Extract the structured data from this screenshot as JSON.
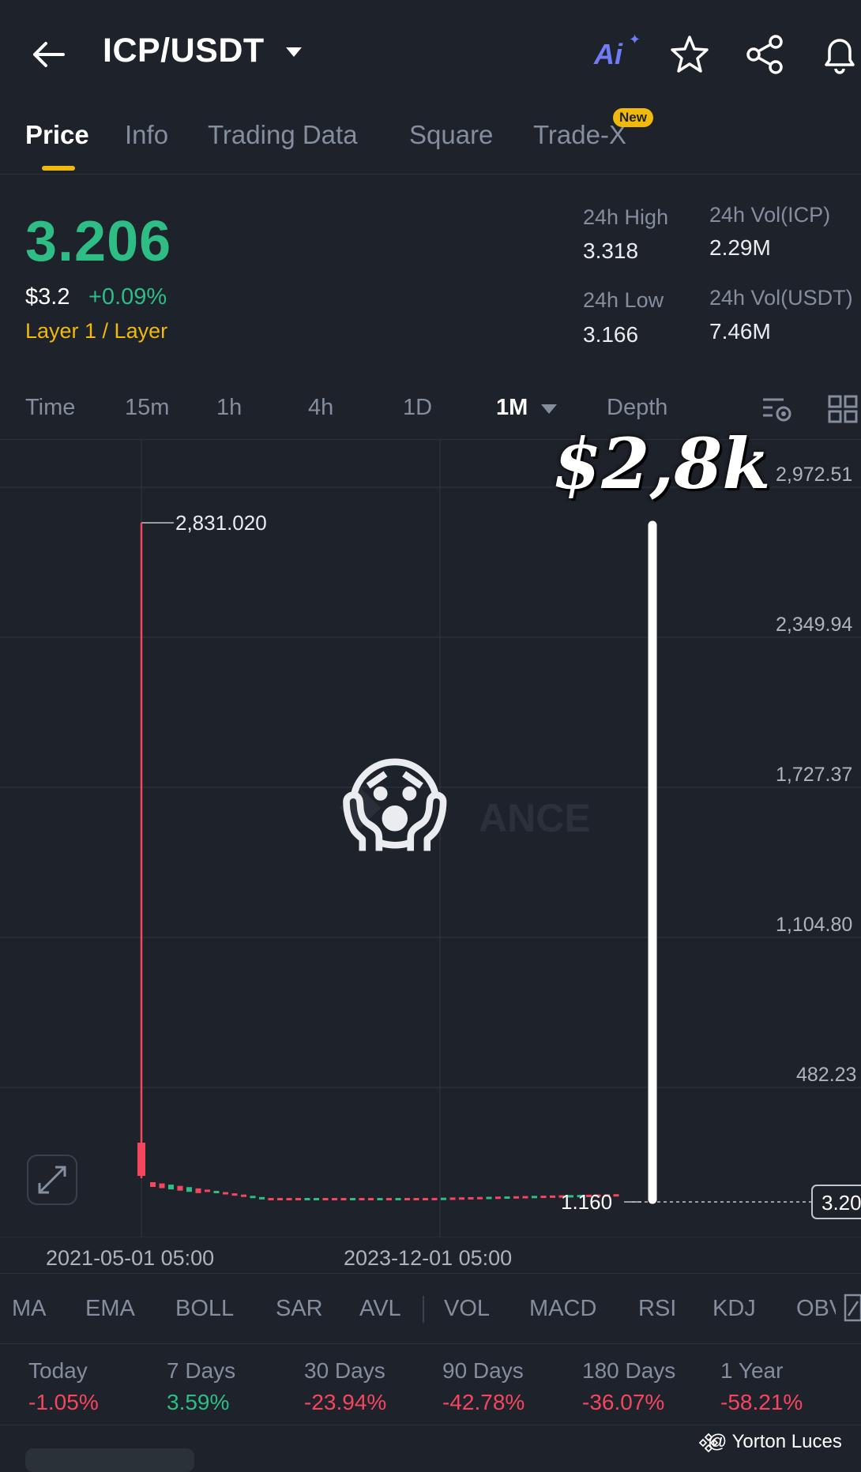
{
  "header": {
    "pair": "ICP/USDT",
    "ai_label": "Ai",
    "icons": [
      "back-arrow-icon",
      "caret-down-icon",
      "ai-icon",
      "star-icon",
      "share-icon",
      "bell-icon"
    ]
  },
  "tabs": [
    {
      "label": "Price",
      "active": true
    },
    {
      "label": "Info"
    },
    {
      "label": "Trading Data"
    },
    {
      "label": "Square"
    },
    {
      "label": "Trade-X",
      "badge": "New"
    }
  ],
  "ticker": {
    "last_price": "3.206",
    "usd_price": "$3.2",
    "change": "+0.09%",
    "category": "Layer 1 / Layer",
    "high_label": "24h High",
    "high_value": "3.318",
    "low_label": "24h Low",
    "low_value": "3.166",
    "vol_icp_label": "24h Vol(ICP)",
    "vol_icp_value": "2.29M",
    "vol_usdt_label": "24h Vol(USDT)",
    "vol_usdt_value": "7.46M"
  },
  "timeframes": [
    {
      "label": "Time"
    },
    {
      "label": "15m"
    },
    {
      "label": "1h"
    },
    {
      "label": "4h"
    },
    {
      "label": "1D"
    },
    {
      "label": "1M",
      "active": true
    },
    {
      "label": "Depth"
    }
  ],
  "chart_data": {
    "type": "candlestick",
    "y_tick_labels": [
      "2,972.51",
      "2,349.94",
      "1,727.37",
      "1,104.80",
      "482.23"
    ],
    "x_tick_labels": [
      "2021-05-01 05:00",
      "2023-12-01 05:00"
    ],
    "high_marker": "2,831.020",
    "low_marker": "1.160",
    "current_price_tag": "3.20",
    "watermark_text": "ANCE",
    "annotation": "$2,8k",
    "colors": {
      "up": "#2ebd85",
      "down": "#f6465d",
      "highlight": "#22e03a"
    }
  },
  "indicators": [
    "MA",
    "EMA",
    "BOLL",
    "SAR",
    "AVL",
    "VOL",
    "MACD",
    "RSI",
    "KDJ",
    "OBV"
  ],
  "performance": [
    {
      "label": "Today",
      "value": "-1.05%",
      "dir": "neg"
    },
    {
      "label": "7 Days",
      "value": "3.59%",
      "dir": "pos"
    },
    {
      "label": "30 Days",
      "value": "-23.94%",
      "dir": "neg"
    },
    {
      "label": "90 Days",
      "value": "-42.78%",
      "dir": "neg"
    },
    {
      "label": "180 Days",
      "value": "-36.07%",
      "dir": "neg"
    },
    {
      "label": "1 Year",
      "value": "-58.21%",
      "dir": "neg"
    }
  ],
  "credit": "@ Yorton Luces"
}
